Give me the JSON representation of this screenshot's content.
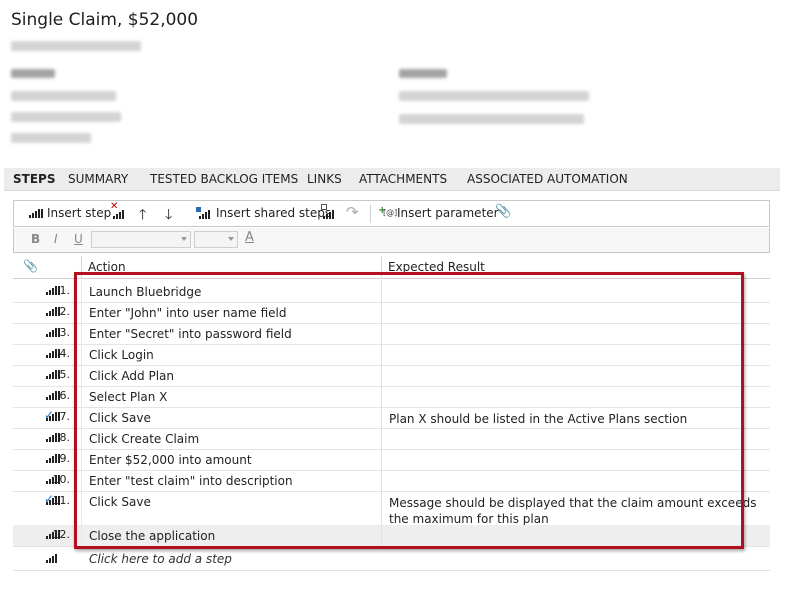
{
  "header": {
    "title": "Single Claim, $52,000"
  },
  "tabs": [
    {
      "label": "STEPS",
      "active": true
    },
    {
      "label": "SUMMARY"
    },
    {
      "label": "TESTED BACKLOG ITEMS"
    },
    {
      "label": "LINKS"
    },
    {
      "label": "ATTACHMENTS"
    },
    {
      "label": "ASSOCIATED AUTOMATION"
    }
  ],
  "toolbar": {
    "insert_step": "Insert step",
    "insert_shared_steps": "Insert shared steps",
    "insert_parameter": "Insert parameter"
  },
  "format_bar": {
    "bold": "B",
    "italic": "I",
    "underline": "U",
    "font_color": "A"
  },
  "grid": {
    "col_action": "Action",
    "col_expected": "Expected Result",
    "add_step": "Click here to add a step"
  },
  "steps": [
    {
      "num": "1.",
      "action": "Launch Bluebridge",
      "expected": ""
    },
    {
      "num": "2.",
      "action": "Enter \"John\" into user name field",
      "expected": ""
    },
    {
      "num": "3.",
      "action": "Enter \"Secret\" into password field",
      "expected": ""
    },
    {
      "num": "4.",
      "action": "Click Login",
      "expected": ""
    },
    {
      "num": "5.",
      "action": "Click Add Plan",
      "expected": ""
    },
    {
      "num": "6.",
      "action": "Select Plan X",
      "expected": ""
    },
    {
      "num": "7.",
      "action": "Click Save",
      "expected": "Plan X should be listed in the Active Plans section",
      "validate": true
    },
    {
      "num": "8.",
      "action": "Click Create Claim",
      "expected": ""
    },
    {
      "num": "9.",
      "action": "Enter $52,000 into amount",
      "expected": ""
    },
    {
      "num": "10.",
      "action": "Enter \"test claim\" into description",
      "expected": ""
    },
    {
      "num": "11.",
      "action": "Click Save",
      "expected": "Message should be displayed that the claim amount exceeds the maximum for this plan",
      "validate": true
    },
    {
      "num": "12.",
      "action": "Close the application",
      "expected": "",
      "selected": true
    }
  ],
  "colors": {
    "highlight": "#b01020",
    "check": "#1f6fd0"
  }
}
